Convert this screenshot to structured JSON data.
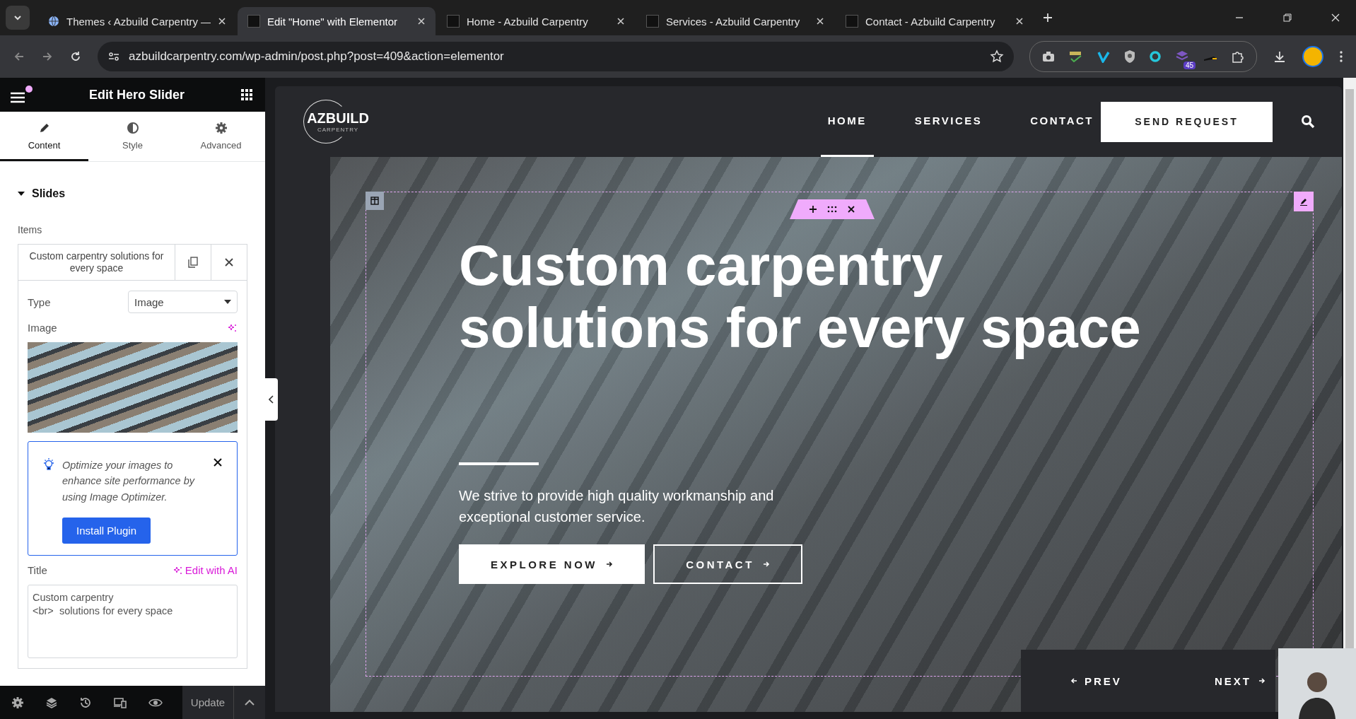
{
  "browser": {
    "tabs": [
      {
        "title": "Themes ‹ Azbuild Carpentry —",
        "selected": false
      },
      {
        "title": "Edit \"Home\" with Elementor",
        "selected": true
      },
      {
        "title": "Home - Azbuild Carpentry",
        "selected": false
      },
      {
        "title": "Services - Azbuild Carpentry",
        "selected": false
      },
      {
        "title": "Contact - Azbuild Carpentry",
        "selected": false
      }
    ],
    "url": "azbuildcarpentry.com/wp-admin/post.php?post=409&action=elementor",
    "extension_badge": "45"
  },
  "editor": {
    "title": "Edit Hero Slider",
    "menu_notification": true,
    "tabs": [
      {
        "label": "Content",
        "selected": true
      },
      {
        "label": "Style",
        "selected": false
      },
      {
        "label": "Advanced",
        "selected": false
      }
    ],
    "section": {
      "label": "Slides",
      "expanded": true
    },
    "items_label": "Items",
    "repeater_item": {
      "title": "Custom carpentry solutions for every space"
    },
    "type": {
      "label": "Type",
      "value": "Image"
    },
    "image_label": "Image",
    "notice": {
      "text": "Optimize your images to enhance site performance by using Image Optimizer.",
      "button": "Install Plugin"
    },
    "title_field": {
      "label": "Title",
      "ai_link": "Edit with AI",
      "value": "Custom carpentry\n<br>  solutions for every space"
    },
    "footer": {
      "update": "Update"
    }
  },
  "site": {
    "logo": "AZBUILD",
    "tagline": "CARPENTRY",
    "nav": [
      {
        "label": "HOME",
        "selected": true
      },
      {
        "label": "SERVICES",
        "selected": false
      },
      {
        "label": "CONTACT",
        "selected": false
      }
    ],
    "cta": "SEND REQUEST",
    "hero": {
      "title_lines": [
        "Custom carpentry",
        "solutions for every space"
      ],
      "text": "We strive to provide high quality workmanship and exceptional customer service.",
      "buttons": [
        {
          "label": "EXPLORE NOW",
          "kind": "solid"
        },
        {
          "label": "CONTACT",
          "kind": "outline"
        }
      ],
      "prev": "PREV",
      "next": "NEXT"
    }
  }
}
